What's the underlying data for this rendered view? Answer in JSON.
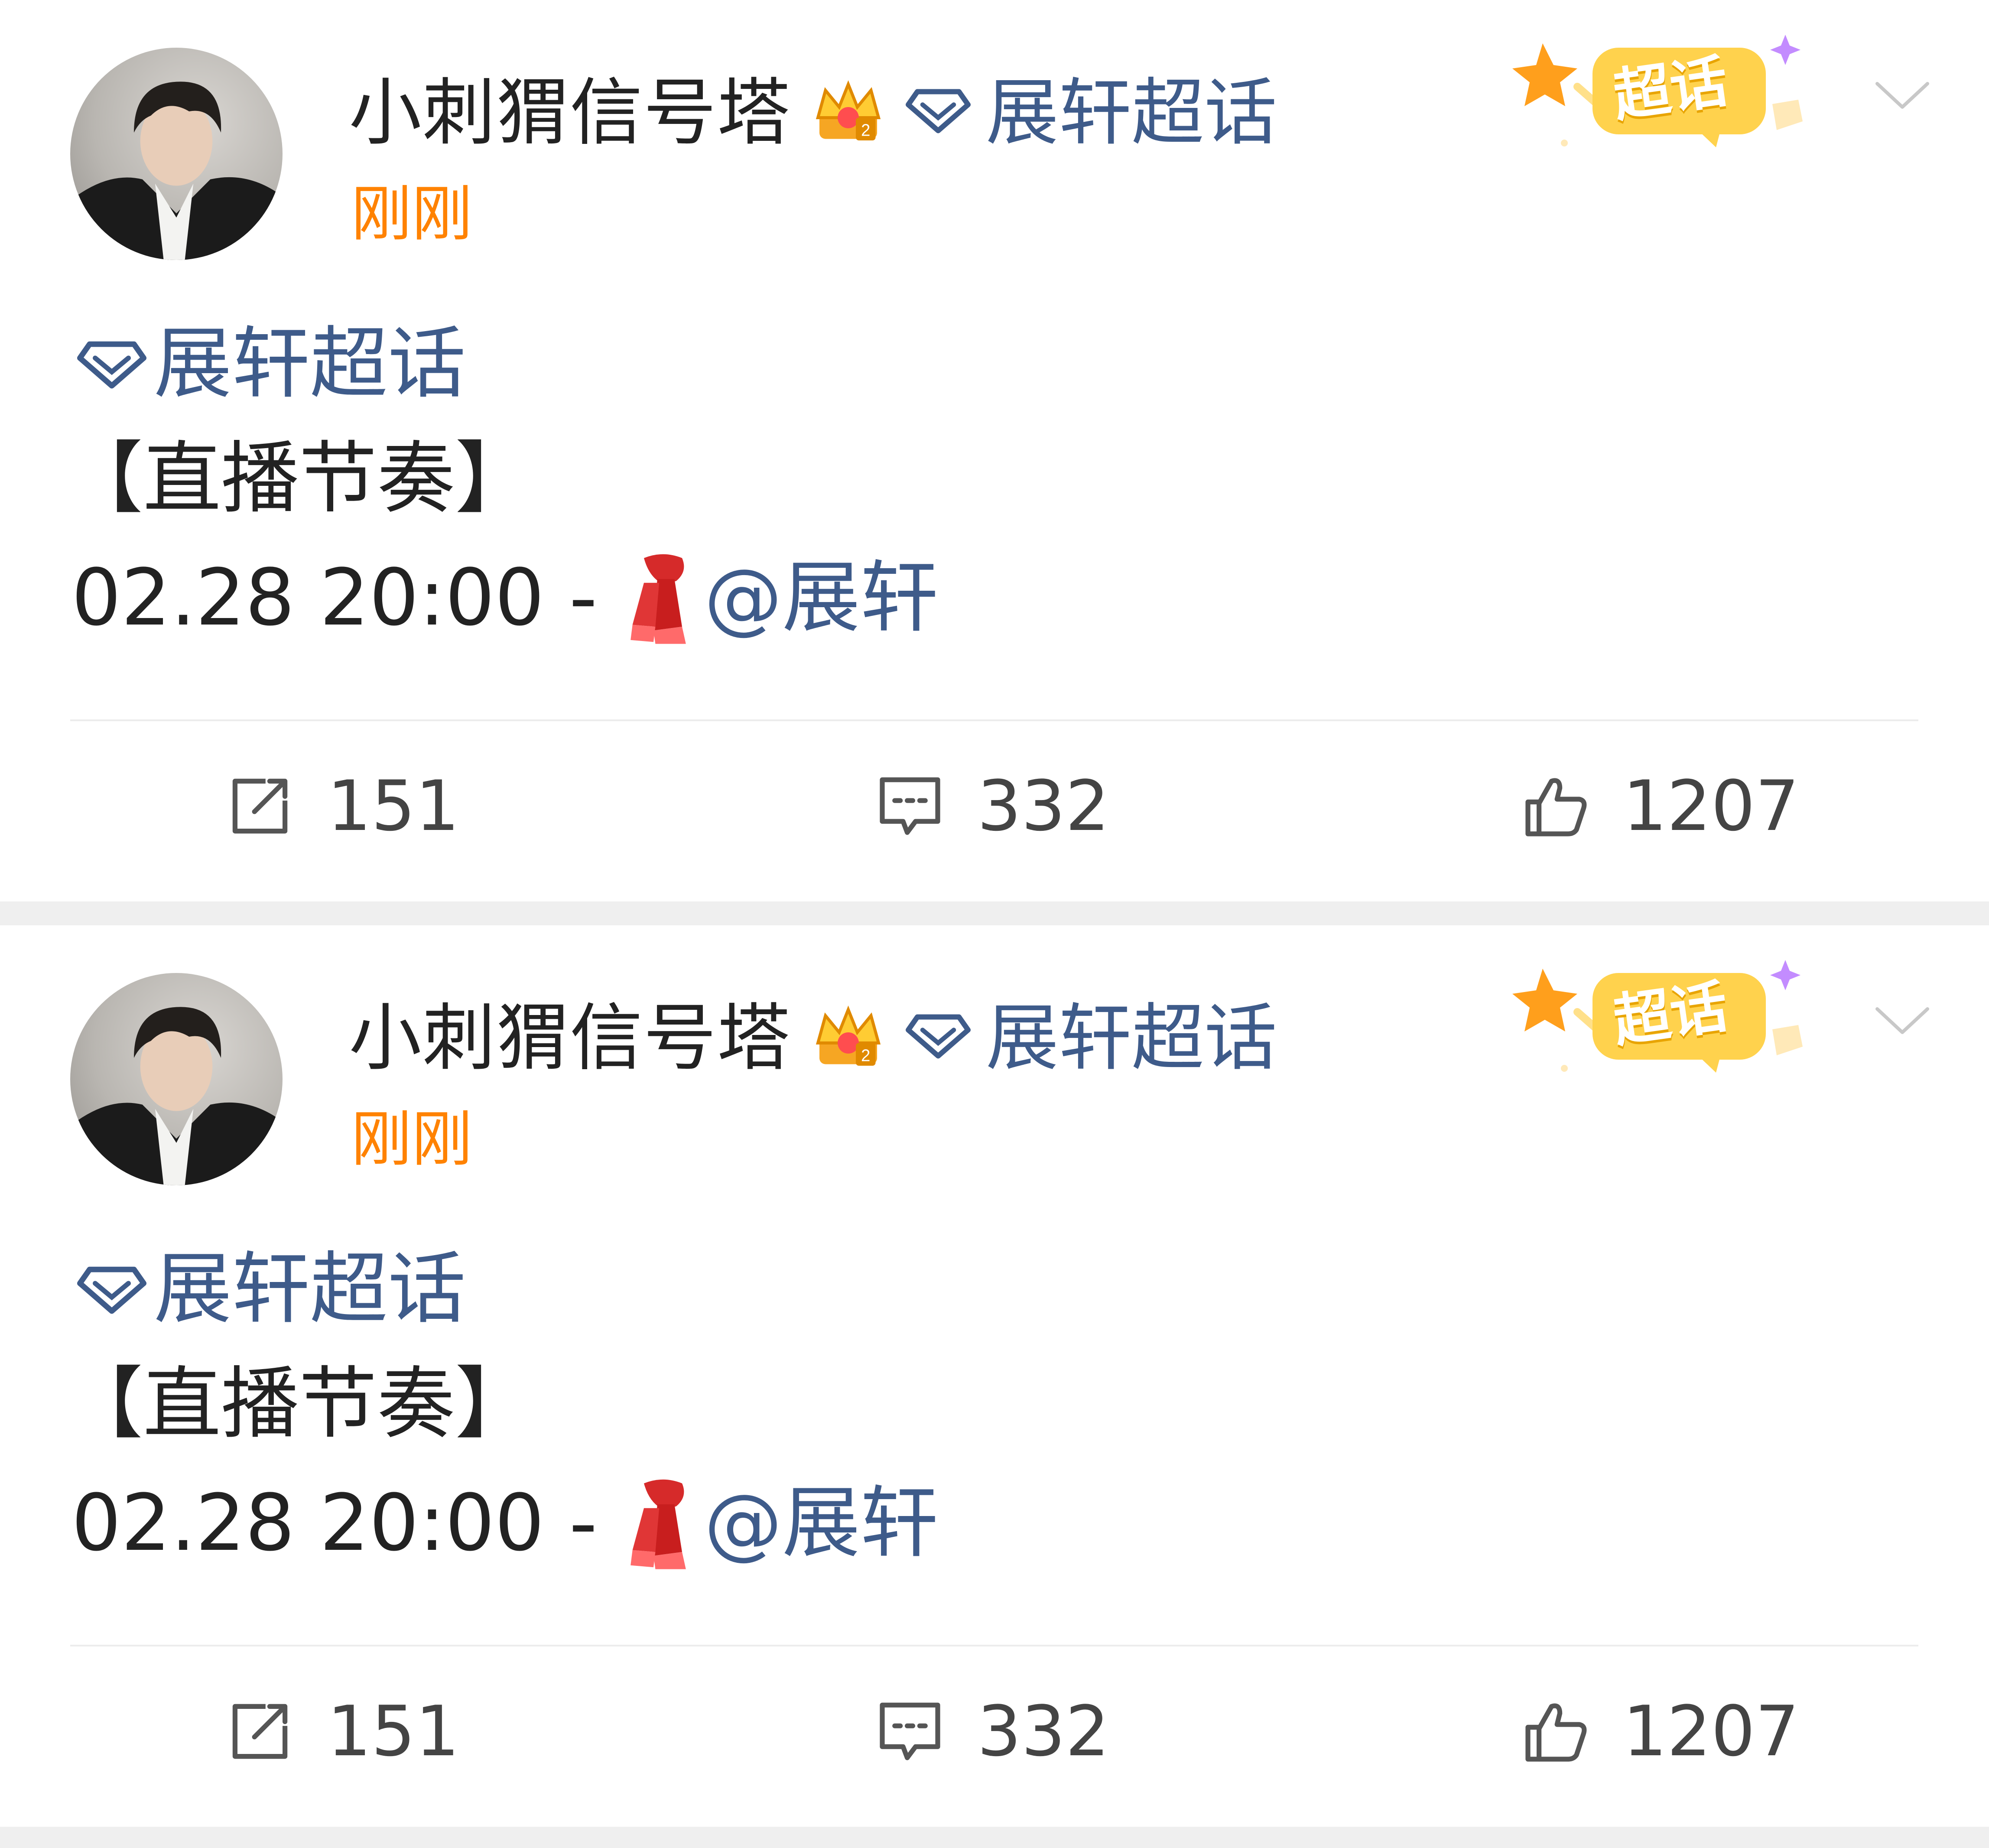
{
  "posts": [
    {
      "username": "小刺猬信号塔",
      "header_topic": "展轩超话",
      "time": "刚刚",
      "super_badge_label": "超话",
      "topic": "展轩超话",
      "title": "【直播节奏】",
      "datetime": "02.28 20:00 -",
      "mention": "@展轩",
      "reposts": "151",
      "comments": "332",
      "likes": "1207"
    },
    {
      "username": "小刺猬信号塔",
      "header_topic": "展轩超话",
      "time": "刚刚",
      "super_badge_label": "超话",
      "topic": "展轩超话",
      "title": "【直播节奏】",
      "datetime": "02.28 20:00 -",
      "mention": "@展轩",
      "reposts": "151",
      "comments": "332",
      "likes": "1207"
    }
  ],
  "icons": {
    "avatar": "user-avatar",
    "badge": "crown-badge-icon",
    "topic": "diamond-icon",
    "scarf": "scarf-emoji-icon",
    "menu": "chevron-down-icon",
    "repost": "repost-icon",
    "comment": "comment-icon",
    "like": "like-icon"
  },
  "colors": {
    "link": "#3e5b8a",
    "time": "#ff8200",
    "text": "#222222",
    "count": "#444444",
    "separator": "#efefef",
    "badge": "#ffd24d"
  }
}
